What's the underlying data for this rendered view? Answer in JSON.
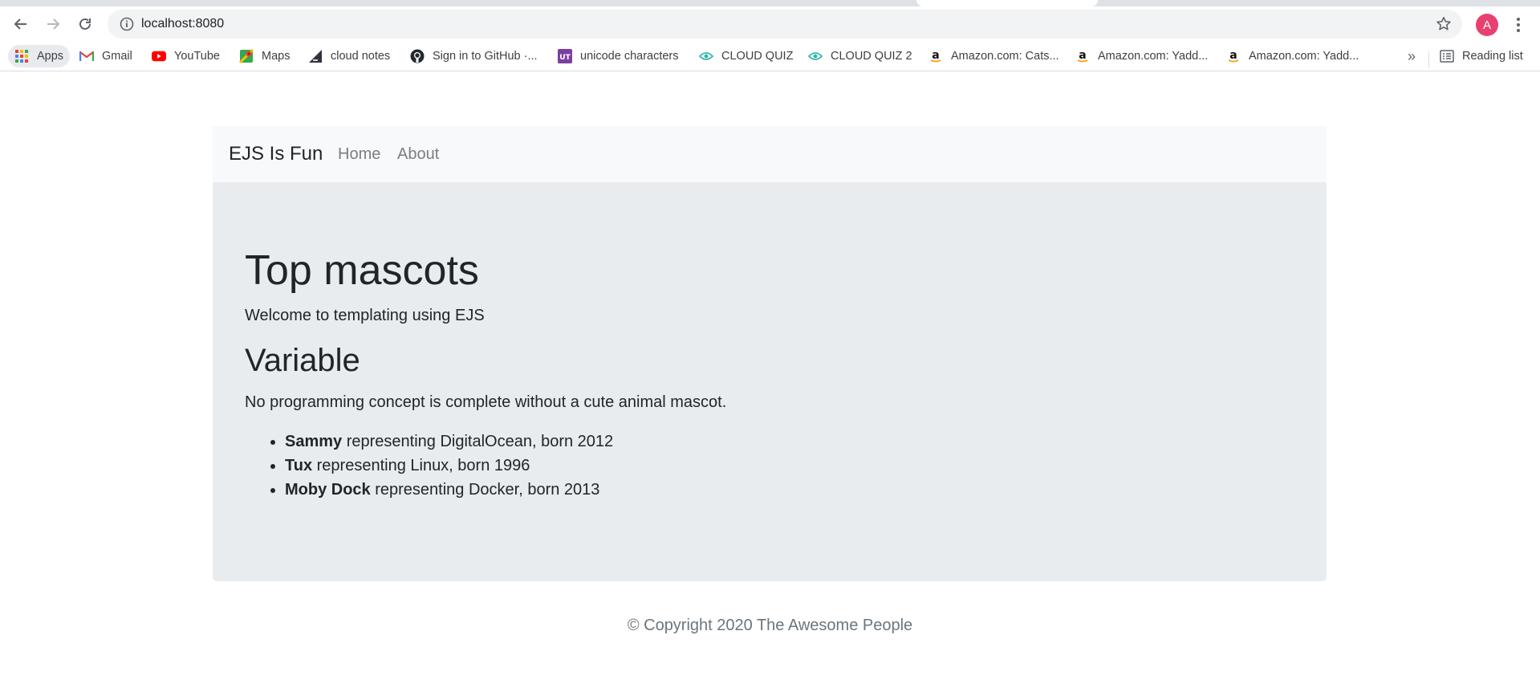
{
  "browser": {
    "url": "localhost:8080",
    "avatar_letter": "A",
    "bookmarks": [
      {
        "label": "Apps",
        "icon": "apps-grid-icon"
      },
      {
        "label": "Gmail",
        "icon": "gmail-icon"
      },
      {
        "label": "YouTube",
        "icon": "youtube-icon"
      },
      {
        "label": "Maps",
        "icon": "maps-icon"
      },
      {
        "label": "cloud notes",
        "icon": "bigcommerce-icon"
      },
      {
        "label": "Sign in to GitHub ·...",
        "icon": "github-icon"
      },
      {
        "label": "unicode characters",
        "icon": "unicode-table-icon"
      },
      {
        "label": "CLOUD QUIZ",
        "icon": "eye-icon"
      },
      {
        "label": "CLOUD QUIZ 2",
        "icon": "eye-icon"
      },
      {
        "label": "Amazon.com: Cats...",
        "icon": "amazon-icon"
      },
      {
        "label": "Amazon.com: Yadd...",
        "icon": "amazon-icon"
      },
      {
        "label": "Amazon.com: Yadd...",
        "icon": "amazon-icon"
      }
    ],
    "overflow_label": "»",
    "reading_list_label": "Reading list"
  },
  "navbar": {
    "brand": "EJS Is Fun",
    "links": [
      "Home",
      "About"
    ]
  },
  "main": {
    "title": "Top mascots",
    "lead": "Welcome to templating using EJS",
    "subtitle": "Variable",
    "paragraph": "No programming concept is complete without a cute animal mascot.",
    "mascots": [
      {
        "name": "Sammy",
        "text": " representing DigitalOcean, born 2012"
      },
      {
        "name": "Tux",
        "text": " representing Linux, born 1996"
      },
      {
        "name": "Moby Dock",
        "text": " representing Docker, born 2013"
      }
    ]
  },
  "footer": {
    "text": "© Copyright 2020 The Awesome People"
  },
  "colors": {
    "navbar_bg": "#f8f9fa",
    "jumbotron_bg": "#e9ecef",
    "avatar_bg": "#e8416f",
    "footer_text": "#6c757d"
  }
}
